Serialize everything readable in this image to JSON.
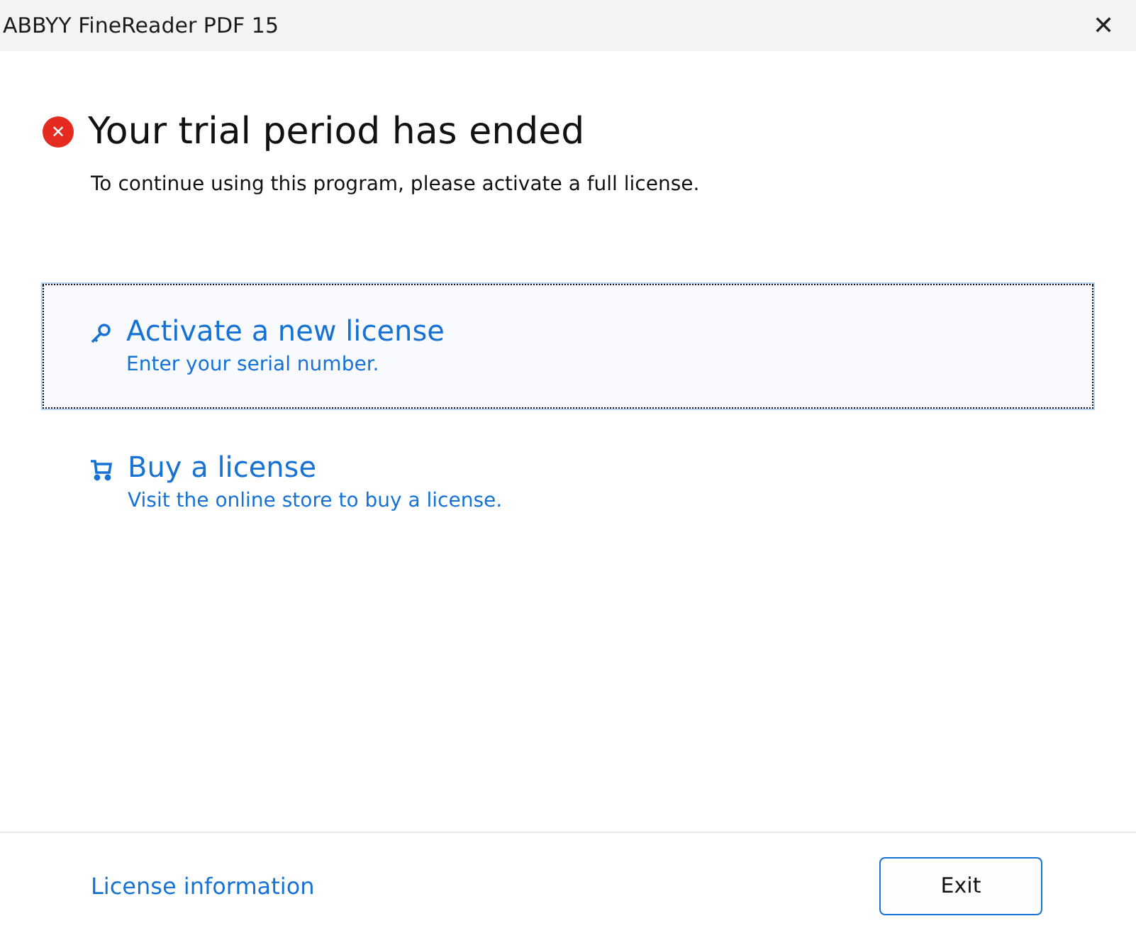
{
  "window": {
    "title": "ABBYY FineReader PDF 15",
    "close": "✕"
  },
  "heading": {
    "icon": "✕",
    "text": "Your trial period has ended"
  },
  "message": "To continue using this program, please activate a full license.",
  "options": [
    {
      "kind": "key",
      "title": "Activate a new license",
      "subtitle": "Enter your serial number.",
      "selected": true
    },
    {
      "kind": "cart",
      "title": "Buy a license",
      "subtitle": "Visit the online store to buy a license.",
      "selected": false
    }
  ],
  "footer": {
    "link": "License information",
    "button": "Exit"
  }
}
